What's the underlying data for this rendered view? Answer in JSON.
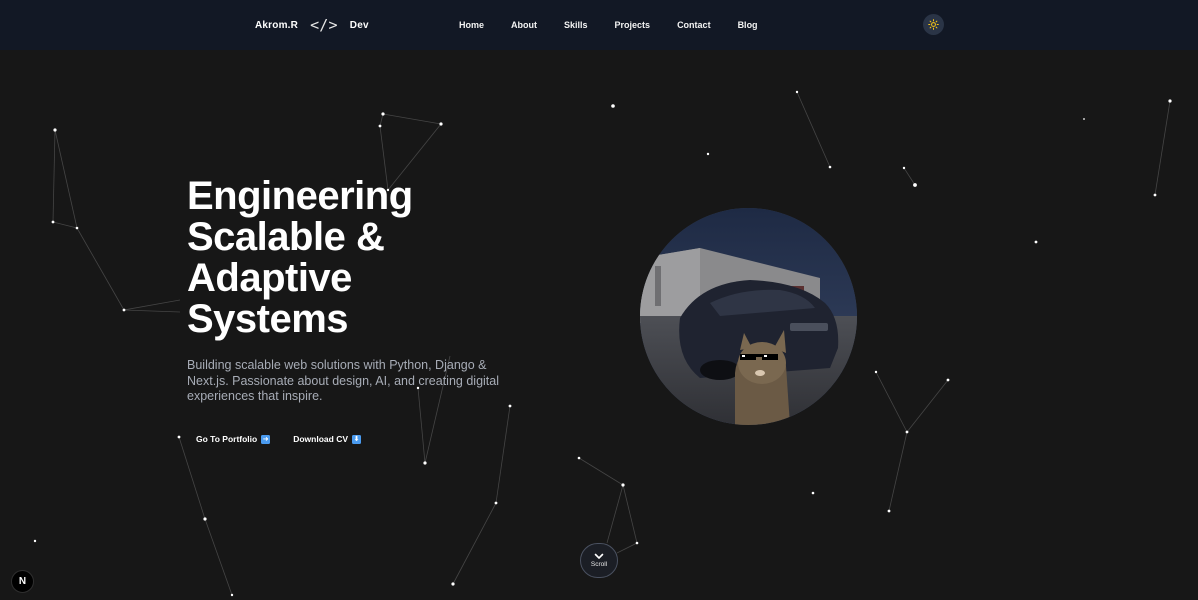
{
  "header": {
    "brand_name": "Akrom.R",
    "brand_code_glyph": "</>",
    "brand_suffix": "Dev",
    "nav": [
      {
        "label": "Home"
      },
      {
        "label": "About"
      },
      {
        "label": "Skills"
      },
      {
        "label": "Projects"
      },
      {
        "label": "Contact"
      },
      {
        "label": "Blog"
      }
    ],
    "theme_toggle_icon": "sun-icon",
    "theme_toggle_color": "#f5c518"
  },
  "hero": {
    "title_lines": [
      "Engineering",
      "Scalable &",
      "Adaptive",
      "Systems"
    ],
    "subtitle": "Building scalable web solutions with Python, Django & Next.js. Passionate about design, AI, and creating digital experiences that inspire.",
    "primary_cta": {
      "label": "Go To Portfolio",
      "icon": "arrow-right-icon"
    },
    "secondary_cta": {
      "label": "Download CV",
      "icon": "arrow-down-icon"
    },
    "accent_color": "#4a9bf0"
  },
  "scroll": {
    "label": "Scroll",
    "icon": "chevron-down-icon"
  },
  "framework_badge": {
    "label": "N"
  }
}
